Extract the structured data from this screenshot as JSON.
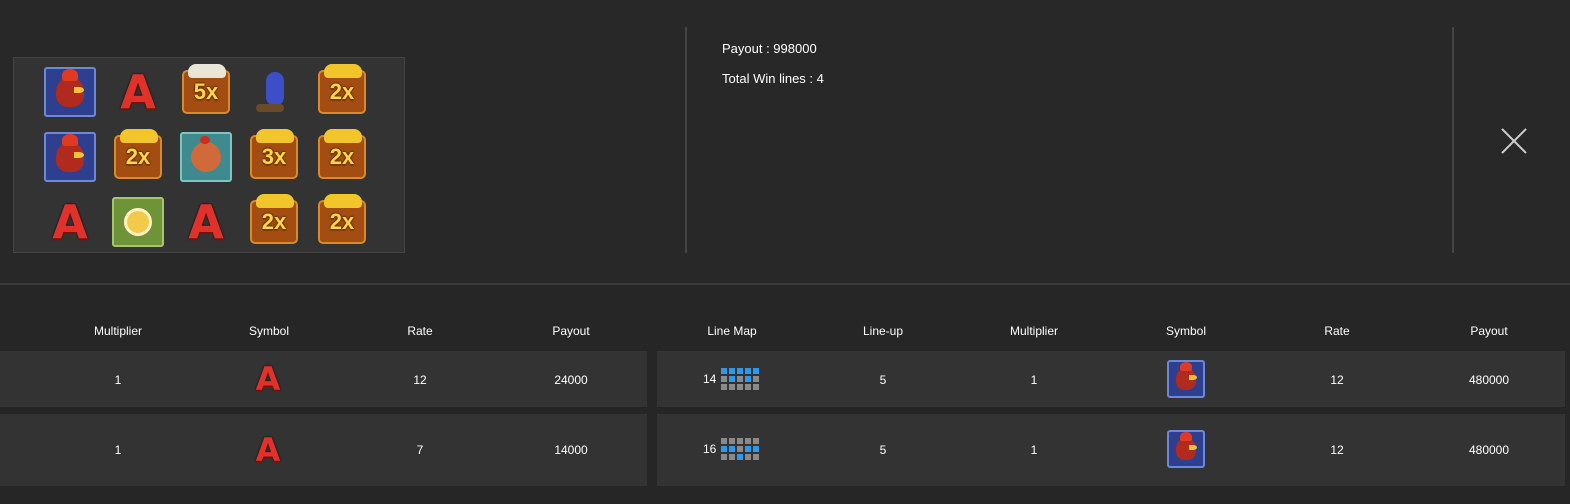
{
  "summary": {
    "payout_label": "Payout : 998000",
    "win_lines_label": "Total Win lines : 4"
  },
  "reels": [
    [
      "rooster",
      "A",
      "5x",
      "worm",
      "2x"
    ],
    [
      "rooster",
      "2x",
      "hen",
      "3x",
      "2x"
    ],
    [
      "A",
      "chick",
      "A",
      "2x",
      "2x"
    ]
  ],
  "table": {
    "left_headers": [
      "Multiplier",
      "Symbol",
      "Rate",
      "Payout"
    ],
    "right_headers": [
      "Line Map",
      "Line-up",
      "Multiplier",
      "Symbol",
      "Rate",
      "Payout"
    ],
    "left_rows": [
      {
        "multiplier": "1",
        "symbol": "A",
        "rate": "12",
        "payout": "24000"
      },
      {
        "multiplier": "1",
        "symbol": "A",
        "rate": "7",
        "payout": "14000"
      }
    ],
    "right_rows": [
      {
        "line": "14",
        "lineup": "5",
        "multiplier": "1",
        "symbol": "rooster",
        "rate": "12",
        "payout": "480000"
      },
      {
        "line": "16",
        "lineup": "5",
        "multiplier": "1",
        "symbol": "rooster",
        "rate": "12",
        "payout": "480000"
      }
    ]
  },
  "colors": {
    "background": "#262626",
    "row_background": "#333333",
    "linemap_active": "#2f98e8",
    "linemap_inactive": "#8a8a8a"
  },
  "icons": {
    "close": "close-icon"
  }
}
